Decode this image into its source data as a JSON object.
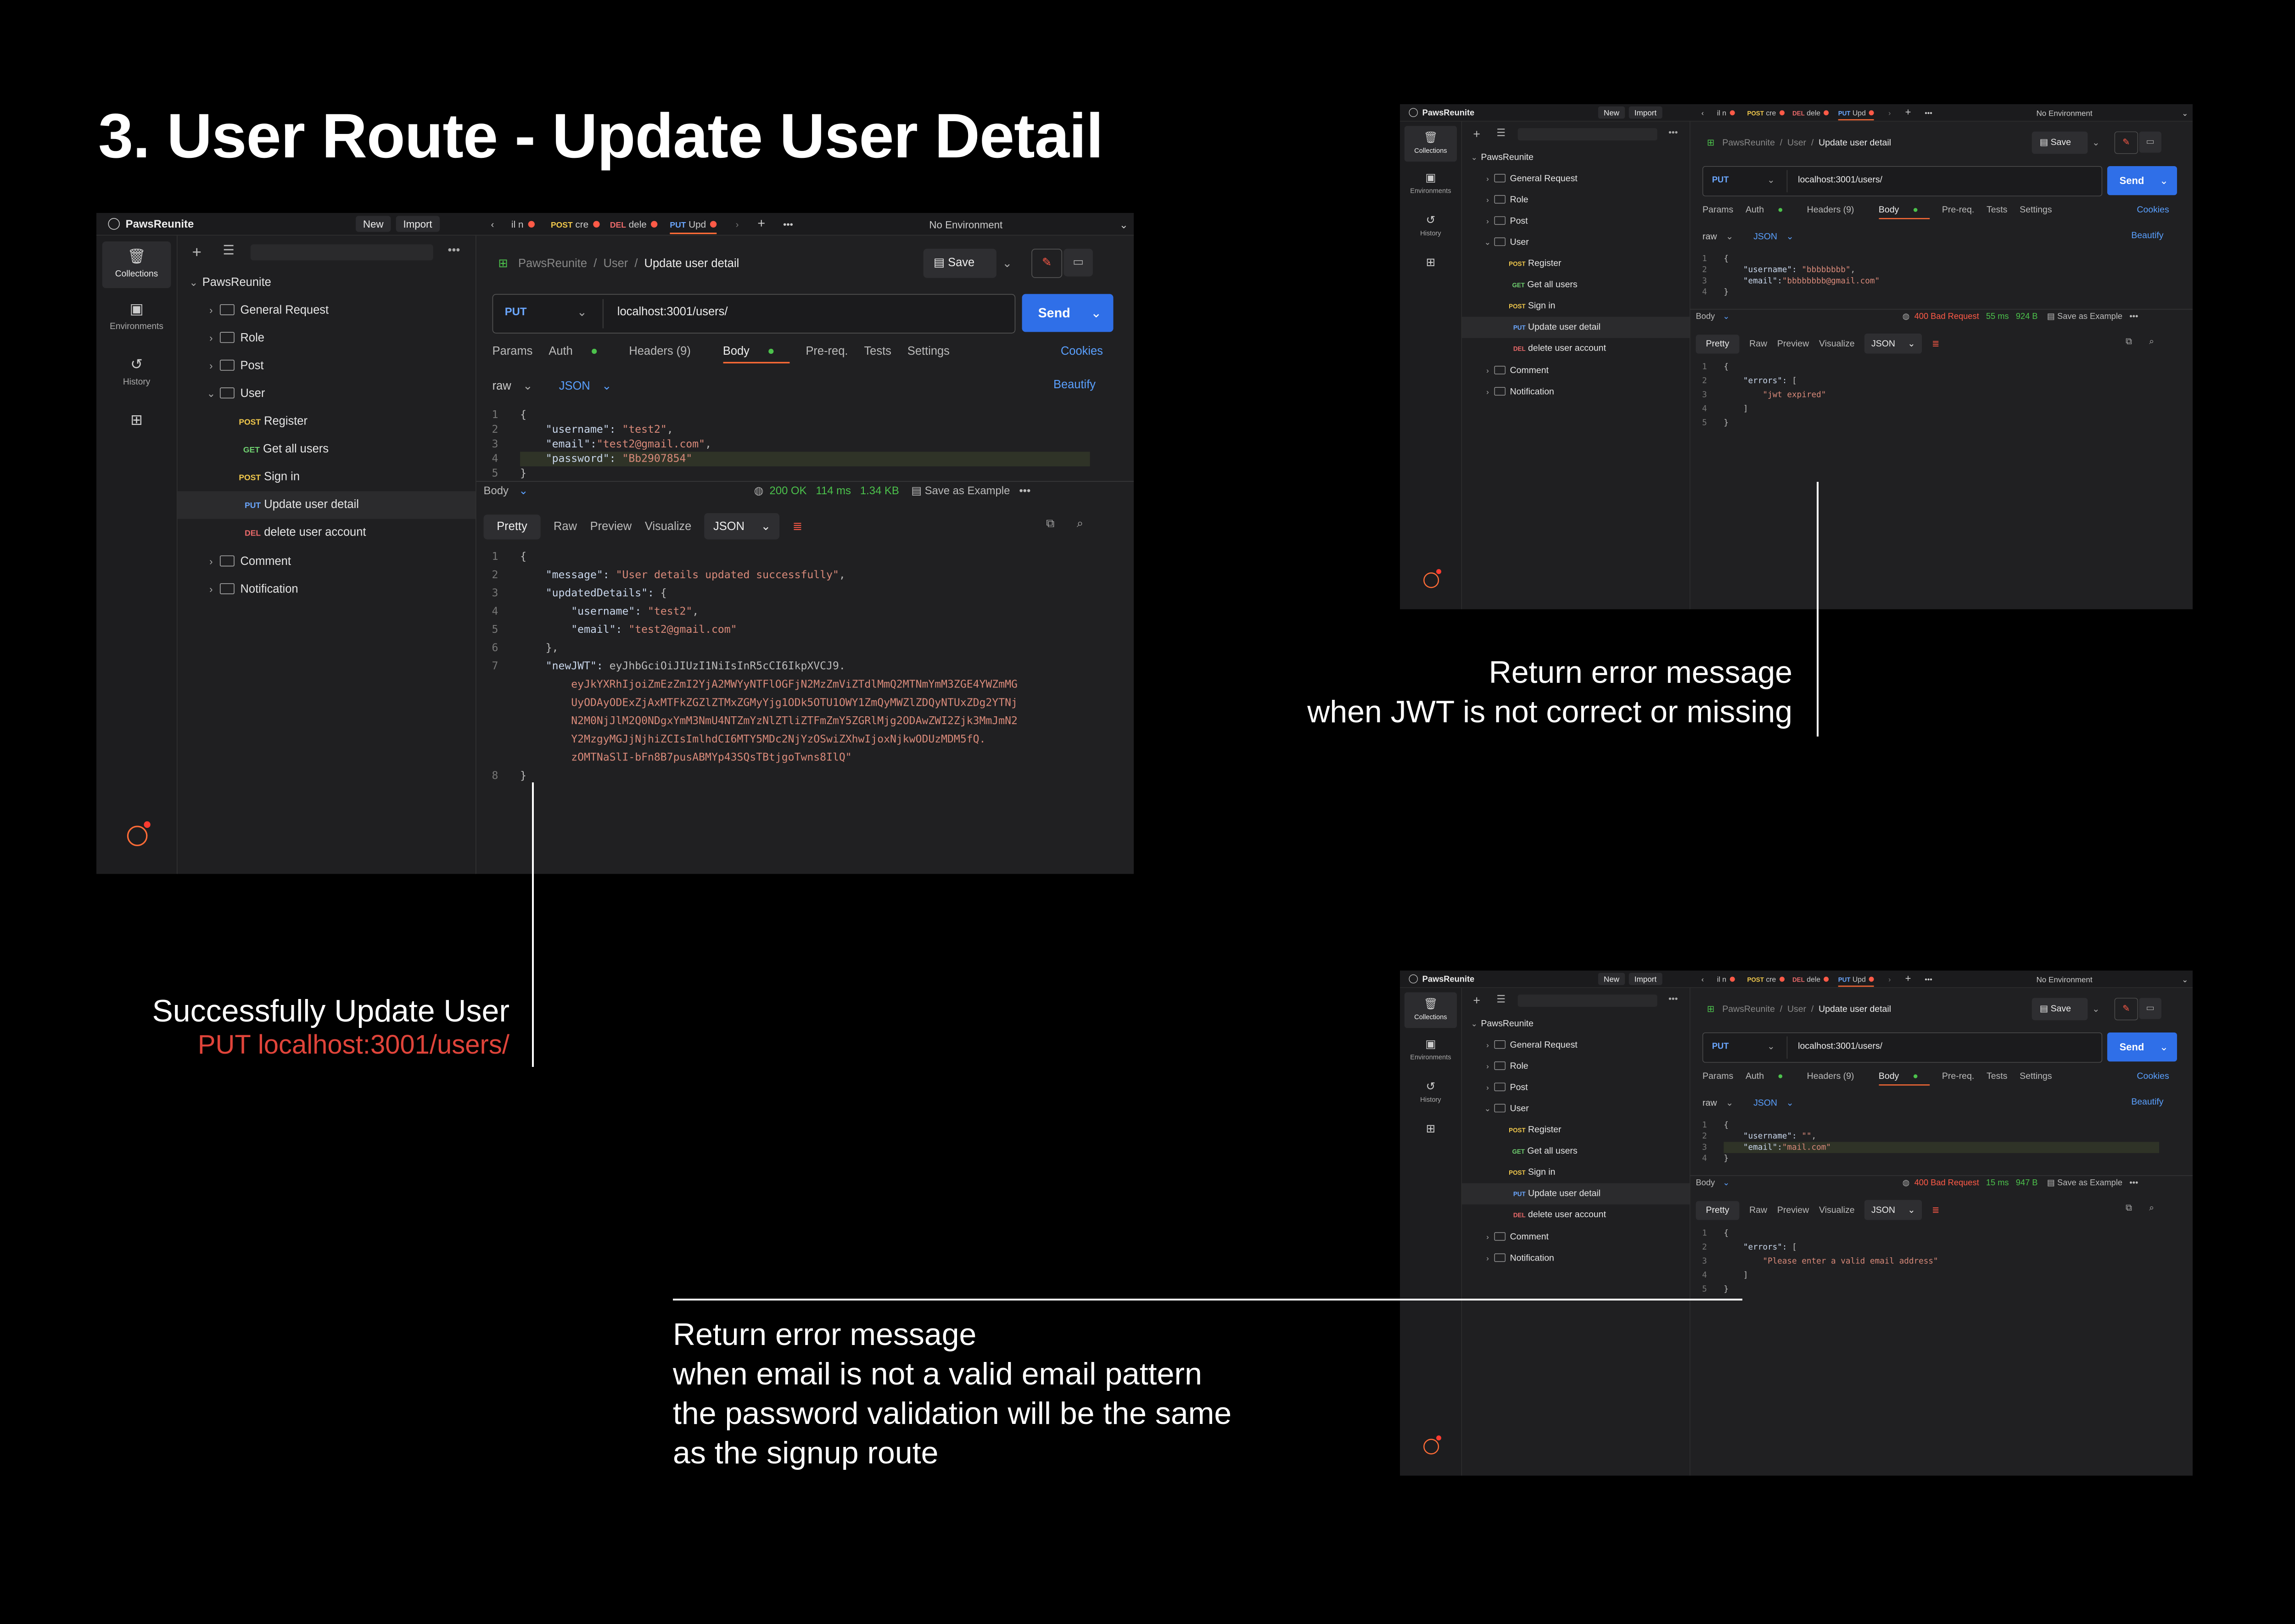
{
  "page_title": "3. User Route - Update User Detail",
  "captions": {
    "success_title": "Successfully Update User",
    "success_sub": "PUT  localhost:3001/users/",
    "jwt_line1": "Return error message",
    "jwt_line2": "when JWT is not correct or missing",
    "email_line1": "Return error message",
    "email_line2": "when email is not a valid email pattern",
    "email_line3": "the password validation will be the same",
    "email_line4": "as the signup route"
  },
  "app": {
    "workspace": "PawsReunite",
    "new_label": "New",
    "import_label": "Import",
    "environment": "No Environment",
    "tabs": [
      {
        "method": "",
        "name": "il n"
      },
      {
        "method": "POST",
        "name": "cre"
      },
      {
        "method": "DEL",
        "name": "dele"
      },
      {
        "method": "PUT",
        "name": "Upd"
      }
    ],
    "rail": {
      "collections": "Collections",
      "environments": "Environments",
      "history": "History"
    },
    "tree": {
      "root": "PawsReunite",
      "general": "General Request",
      "role": "Role",
      "post": "Post",
      "user": "User",
      "register_method": "POST",
      "register": "Register",
      "getall_method": "GET",
      "getall": "Get all users",
      "signin_method": "POST",
      "signin": "Sign in",
      "update_method": "PUT",
      "update": "Update user detail",
      "delete_method": "DEL",
      "delete": "delete user account",
      "comment": "Comment",
      "notification": "Notification"
    },
    "crumb_root": "PawsReunite",
    "crumb_mid": "User",
    "crumb_leaf": "Update user detail",
    "save_label": "Save",
    "method": "PUT",
    "url": "localhost:3001/users/",
    "send_label": "Send",
    "subtabs": {
      "params": "Params",
      "auth": "Auth",
      "headers": "Headers (9)",
      "body": "Body",
      "prereq": "Pre-req.",
      "tests": "Tests",
      "settings": "Settings"
    },
    "cookies": "Cookies",
    "raw": "raw",
    "json": "JSON",
    "beautify": "Beautify",
    "resp_body": "Body",
    "save_example": "Save as Example",
    "res_tabs": {
      "pretty": "Pretty",
      "raw": "Raw",
      "preview": "Preview",
      "visualize": "Visualize",
      "json": "JSON"
    }
  },
  "shots": {
    "success": {
      "status": "200 OK",
      "time": "114 ms",
      "size": "1.34 KB",
      "request_lines": [
        "{",
        "    \"username\": \"test2\",",
        "    \"email\":\"test2@gmail.com\",",
        "    \"password\": \"Bb2907854\"",
        "}"
      ],
      "response_lines": [
        "{",
        "    \"message\": \"User details updated successfully\",",
        "    \"updatedDetails\": {",
        "        \"username\": \"test2\",",
        "        \"email\": \"test2@gmail.com\"",
        "    },",
        "    \"newJWT\": \"eyJhbGciOiJIUzI1NiIsInR5cCI6IkpXVCJ9.",
        "        eyJkYXRhIjoiZmEzZmI2YjA2MWYyNTFlOGFjN2MzZmViZTdlMmQ2MTNmYmM3ZGE4YWZmMG",
        "        UyODAyODExZjAxMTFkZGZlZTMxZGMyYjg1ODk5OTU1OWY1ZmQyMWZlZDQyNTUxZDg2YTNj",
        "        N2M0NjJlM2Q0NDgxYmM3NmU4NTZmYzNlZTliZTFmZmY5ZGRlMjg2ODAwZWI2Zjk3MmJmN2",
        "        Y2MzgyMGJjNjhiZCIsImlhdCI6MTY5MDc2NjYzOSwiZXhwIjoxNjkwODUzMDM5fQ.",
        "        zOMTNaSlI-bFn8B7pusABMYp43SQsTBtjgoTwns8IlQ\"",
        "}"
      ],
      "response_line_numbers": [
        "1",
        "2",
        "3",
        "4",
        "5",
        "6",
        "7",
        "",
        "",
        "",
        "",
        "",
        "8"
      ]
    },
    "jwt": {
      "status": "400 Bad Request",
      "time": "55 ms",
      "size": "924 B",
      "request_lines": [
        "{",
        "    \"username\": \"bbbbbbbb\",",
        "    \"email\":\"bbbbbbbb@gmail.com\"",
        "}"
      ],
      "response_lines": [
        "{",
        "    \"errors\": [",
        "        \"jwt expired\"",
        "    ]",
        "}"
      ]
    },
    "email": {
      "status": "400 Bad Request",
      "time": "15 ms",
      "size": "947 B",
      "request_lines": [
        "{",
        "    \"username\": \"\",",
        "    \"email\":\"mail.com\"",
        "}"
      ],
      "response_lines": [
        "{",
        "    \"errors\": [",
        "        \"Please enter a valid email address\"",
        "    ]",
        "}"
      ]
    }
  }
}
